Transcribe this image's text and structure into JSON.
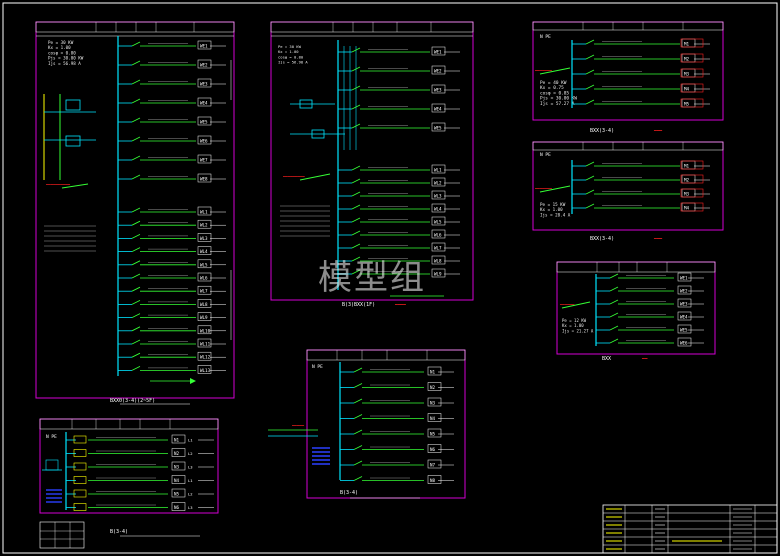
{
  "watermark": "模型组",
  "panels": {
    "p1": {
      "title": "BXX0(3-4)(2~5F)",
      "params": [
        "Pe = 30 KW",
        "Kx = 1.00",
        "cosφ = 0.80",
        "Pjs = 30.00 KW",
        "Ijs = 56.98 A"
      ],
      "we_ids": [
        "WE1",
        "WE2",
        "WE3",
        "WE4",
        "WE5",
        "WE6",
        "WE7",
        "WE8"
      ],
      "wl_ids": [
        "WL1",
        "WL2",
        "WL3",
        "WL4",
        "WL5",
        "WL6",
        "WL7",
        "WL8",
        "WL9",
        "WL10",
        "WL11",
        "WL12",
        "WL13"
      ]
    },
    "p2": {
      "title": "B(3)BXX(1F)",
      "params": [
        "Pe = 30 KW",
        "Kx = 1.00",
        "cosφ = 0.80",
        "Ijs = 56.98 A"
      ],
      "we_ids": [
        "WE1",
        "WE2",
        "WE3",
        "WE4",
        "WE5"
      ],
      "wl_ids": [
        "WL1",
        "WL2",
        "WL3",
        "WL4",
        "WL5",
        "WL6",
        "WL7",
        "WL8",
        "WL9"
      ]
    },
    "p3": {
      "title": "BXX(3-4)",
      "params": [
        "Pe = 40 KW",
        "Kx = 0.75",
        "cosφ = 0.85",
        "Pjs = 30.00 KW",
        "Ijs = 57.27 A"
      ],
      "ids": [
        "M1",
        "M2",
        "M3",
        "M4",
        "M5"
      ],
      "pe": [
        "N PE"
      ]
    },
    "p4": {
      "title": "BXX(3-4)",
      "params": [
        "Pe = 15 KW",
        "Kx = 1.00",
        "Ijs = 28.4 A"
      ],
      "ids": [
        "M1",
        "M2",
        "M3",
        "M4"
      ],
      "pe": [
        "N PE"
      ]
    },
    "p5": {
      "title": "B(3-4)",
      "ids": [
        "N1",
        "N2",
        "N3",
        "N4",
        "N5",
        "N6"
      ],
      "phases": [
        "L1",
        "L2",
        "L3",
        "L1",
        "L2",
        "L3"
      ],
      "pe": [
        "N PE"
      ]
    },
    "p6": {
      "title": "B(3-4)",
      "ids": [
        "N1",
        "N2",
        "N3",
        "N4",
        "N5",
        "N6",
        "N7",
        "N8"
      ]
    },
    "p7": {
      "title": "BXX",
      "params": [
        "Pe = 12 KW",
        "Kx = 1.00",
        "Ijs = 21.27 A"
      ],
      "ids": [
        "WE1",
        "WE2",
        "WE3",
        "WE4",
        "WE5",
        "WE6"
      ]
    }
  },
  "colors": {
    "frame": "#d400d4",
    "bus": "#00e5ff",
    "breaker": "#35ff35",
    "text": "#e8e8e8",
    "label_red": "#ff2020",
    "yellow": "#ffff00",
    "blue": "#2a40ff"
  }
}
